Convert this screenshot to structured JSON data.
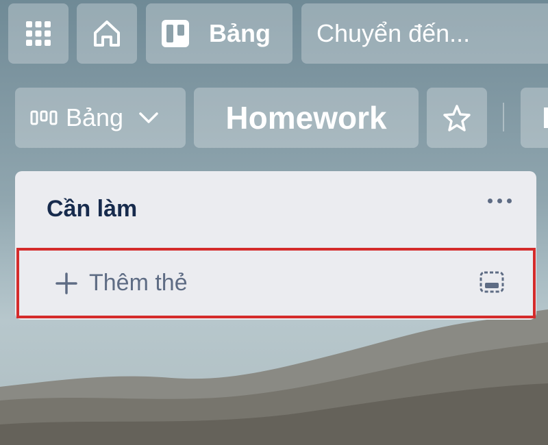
{
  "topbar": {
    "apps_icon": "apps-grid-icon",
    "home_icon": "home-icon",
    "boards_icon": "trello-board-icon",
    "boards_label": "Bảng",
    "search_text": "Chuyển đến..."
  },
  "board_header": {
    "view_icon": "board-columns-icon",
    "view_label": "Bảng",
    "board_title": "Homework",
    "star_icon": "star-icon"
  },
  "list": {
    "title": "Cần làm",
    "menu_icon": "more-icon",
    "add_card_label": "Thêm thẻ",
    "add_icon": "plus-icon",
    "template_icon": "card-template-icon"
  },
  "colors": {
    "highlight_border": "#d42b2b",
    "list_bg": "#ebecf0",
    "list_title": "#172b4d"
  }
}
